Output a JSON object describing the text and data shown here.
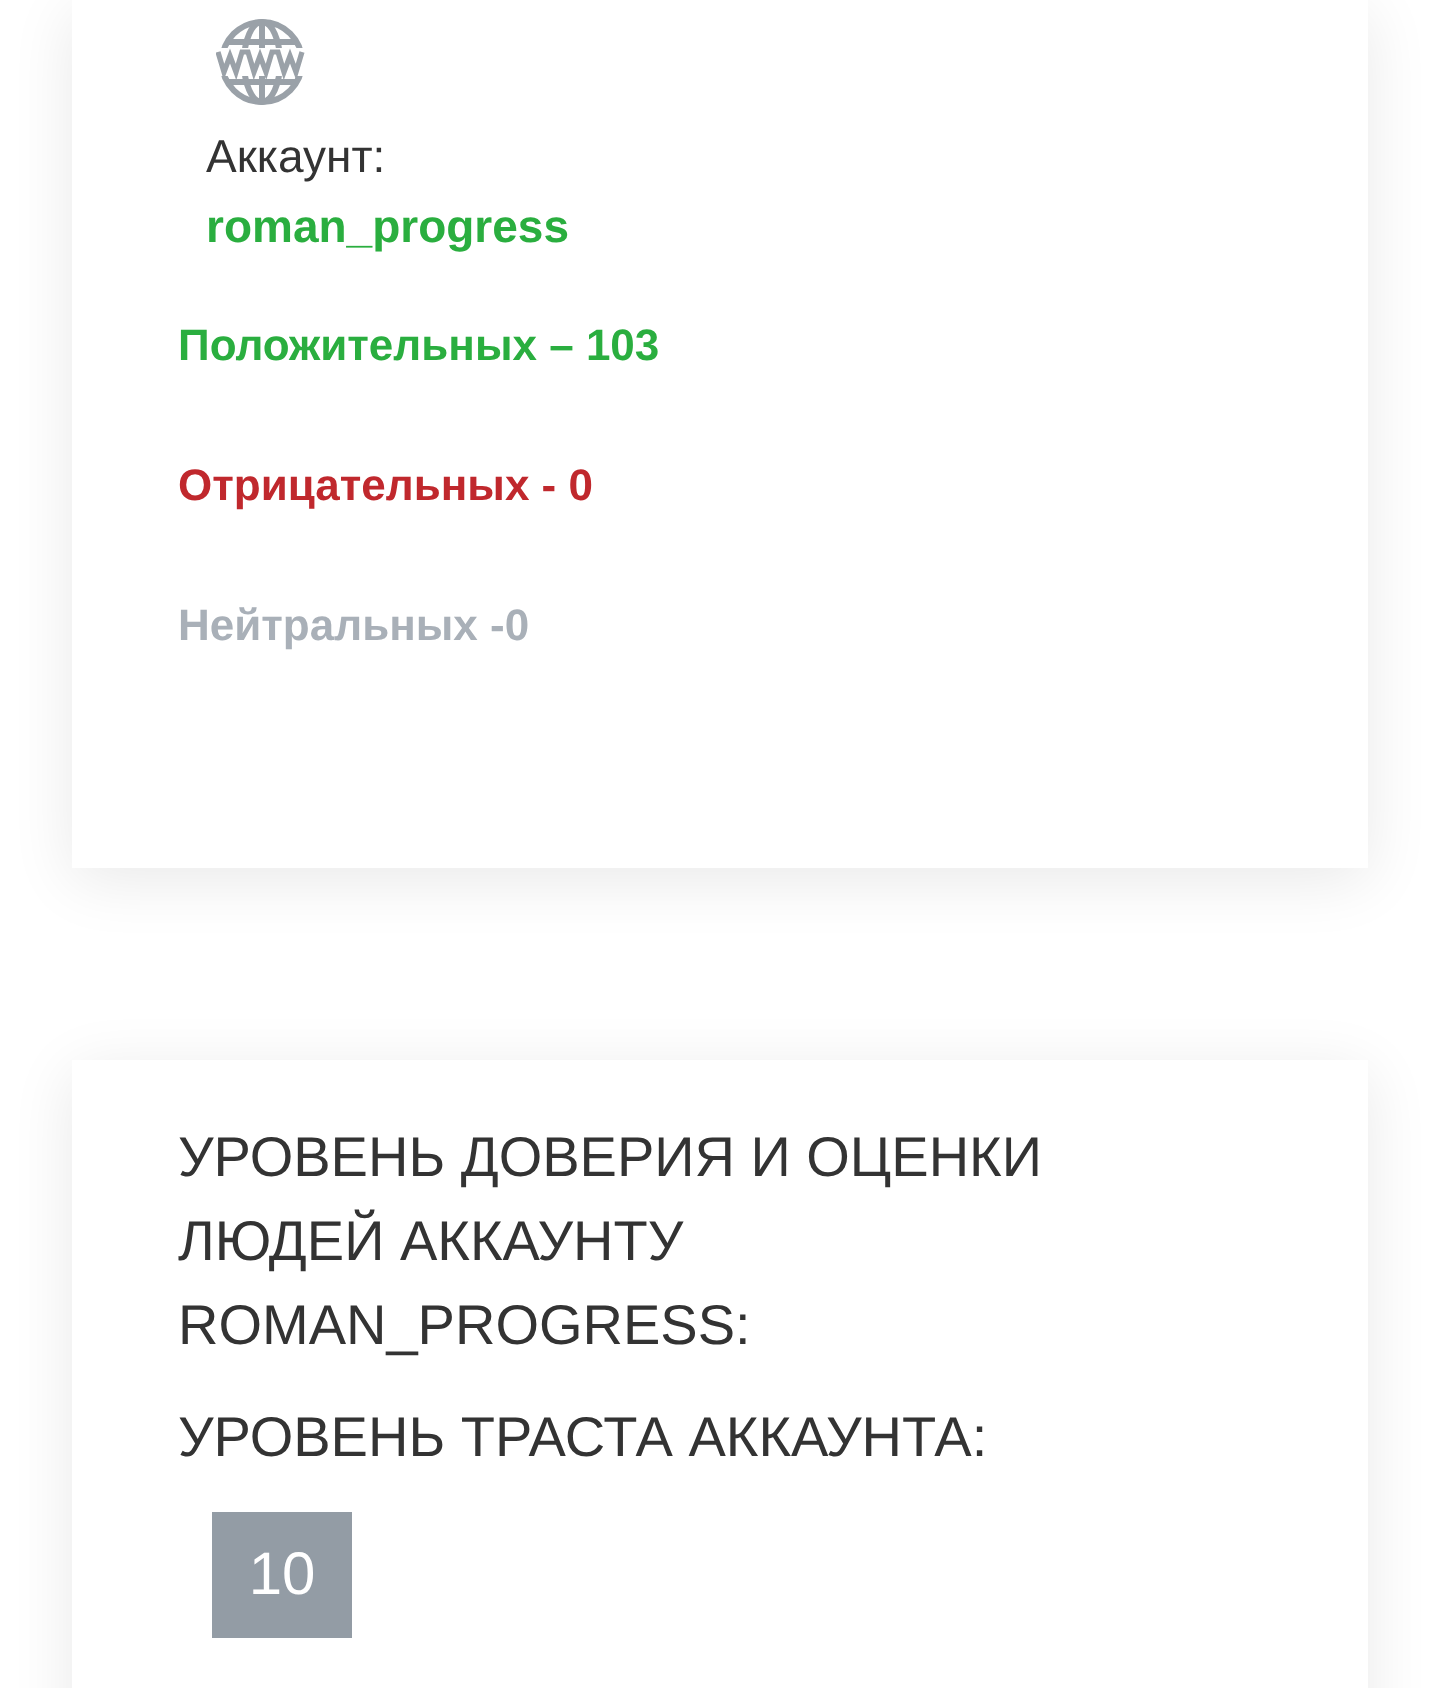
{
  "account_card": {
    "account_label": "Аккаунт:",
    "account_name": "roman_progress",
    "reviews": [
      {
        "kind": "positive",
        "text": "Положительных – 103"
      },
      {
        "kind": "negative",
        "text": "Отрицательных - 0"
      },
      {
        "kind": "neutral",
        "text": "Нейтральных -0"
      }
    ]
  },
  "trust_card": {
    "title": "УРОВЕНЬ ДОВЕРИЯ И ОЦЕНКИ ЛЮДЕЙ АККАУНТУ ROMAN_PROGRESS:",
    "trust_label": "УРОВЕНЬ ТРАСТА АККАУНТА:",
    "trust_value": "10"
  }
}
